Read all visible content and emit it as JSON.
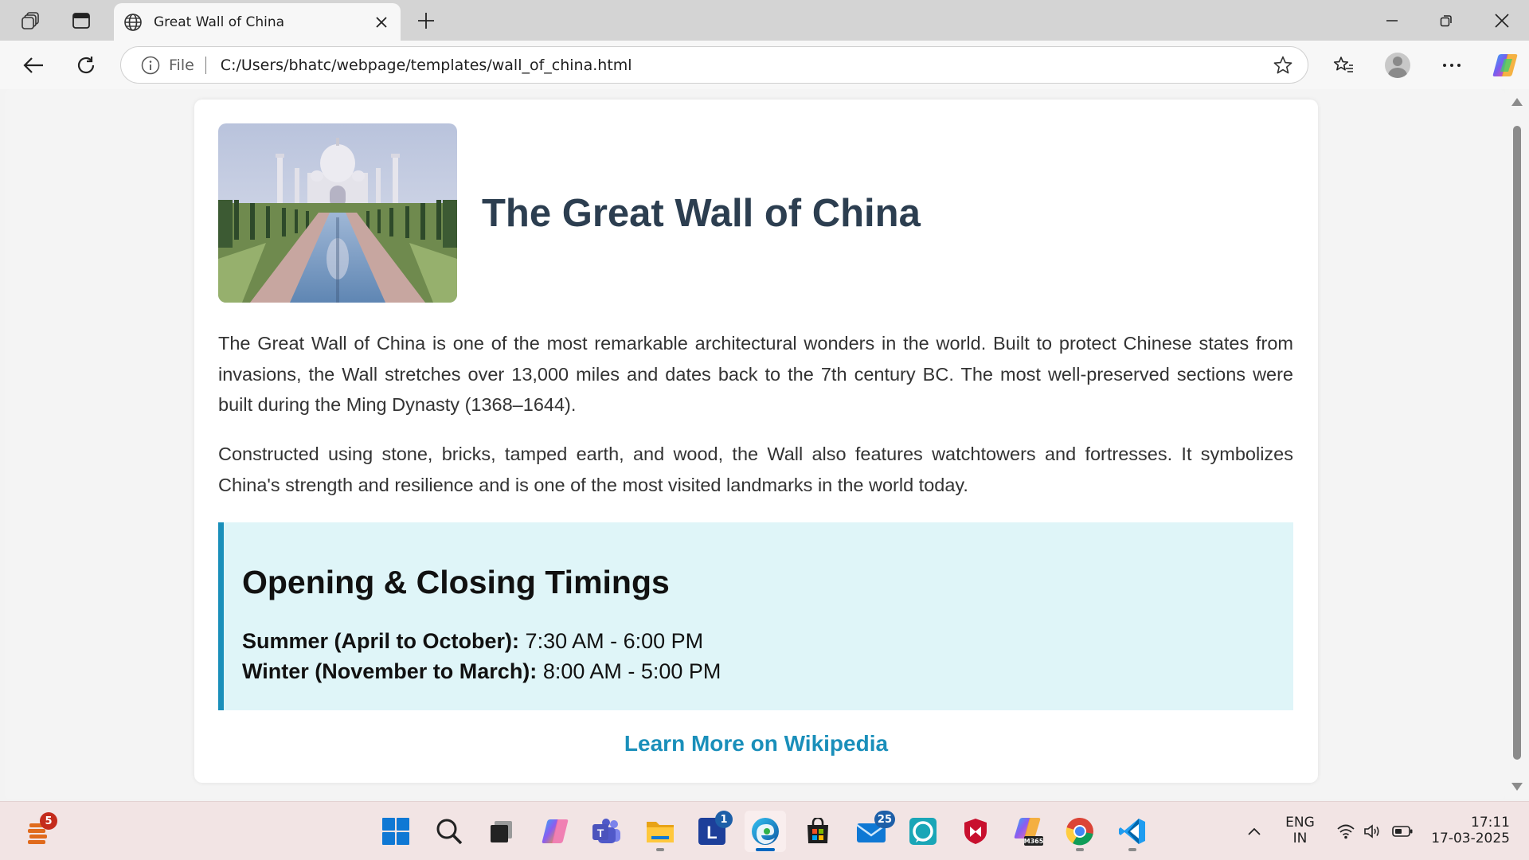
{
  "browser": {
    "tab": {
      "title": "Great Wall of China"
    },
    "address": {
      "scheme_label": "File",
      "url": "C:/Users/bhatc/webpage/templates/wall_of_china.html"
    }
  },
  "page": {
    "image_alt": "Taj Mahal with reflecting pool",
    "title": "The Great Wall of China",
    "paragraphs": [
      "The Great Wall of China is one of the most remarkable architectural wonders in the world. Built to protect Chinese states from invasions, the Wall stretches over 13,000 miles and dates back to the 7th century BC. The most well-preserved sections were built during the Ming Dynasty (1368–1644).",
      "Constructed using stone, bricks, tamped earth, and wood, the Wall also features watchtowers and fortresses. It symbolizes China's strength and resilience and is one of the most visited landmarks in the world today."
    ],
    "timings": {
      "heading": "Opening & Closing Timings",
      "rows": [
        {
          "label": "Summer (April to October):",
          "value": "7:30 AM - 6:00 PM"
        },
        {
          "label": "Winter (November to March):",
          "value": "8:00 AM - 5:00 PM"
        }
      ]
    },
    "link_text": "Learn More on Wikipedia"
  },
  "taskbar": {
    "icons": [
      {
        "name": "widgets-icon",
        "badge": "5"
      },
      {
        "name": "start-icon"
      },
      {
        "name": "search-icon"
      },
      {
        "name": "task-view-icon"
      },
      {
        "name": "copilot-icon"
      },
      {
        "name": "teams-icon"
      },
      {
        "name": "file-explorer-icon"
      },
      {
        "name": "app-l-icon",
        "badge": "1"
      },
      {
        "name": "edge-icon"
      },
      {
        "name": "store-icon"
      },
      {
        "name": "mail-icon",
        "badge": "25"
      },
      {
        "name": "alexa-icon"
      },
      {
        "name": "mcafee-icon"
      },
      {
        "name": "m365-icon",
        "label": "M365"
      },
      {
        "name": "chrome-icon"
      },
      {
        "name": "vscode-icon"
      }
    ],
    "tray": {
      "language": "ENG",
      "region": "IN",
      "time": "17:11",
      "date": "17-03-2025"
    }
  },
  "colors": {
    "title": "#2c3e50",
    "accent": "#1a8fba",
    "timings_bg": "#dff5f8",
    "taskbar_bg": "#f2e4e4"
  }
}
